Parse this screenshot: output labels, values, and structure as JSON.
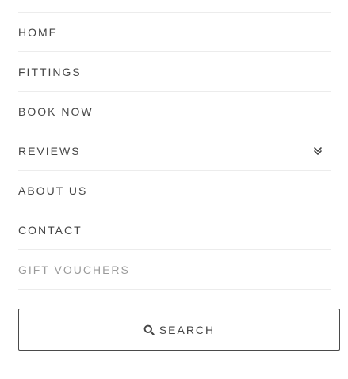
{
  "menu": {
    "items": [
      {
        "label": "HOME",
        "active": false,
        "has_submenu": false
      },
      {
        "label": "FITTINGS",
        "active": false,
        "has_submenu": false
      },
      {
        "label": "BOOK NOW",
        "active": false,
        "has_submenu": false
      },
      {
        "label": "REVIEWS",
        "active": false,
        "has_submenu": true
      },
      {
        "label": "ABOUT US",
        "active": false,
        "has_submenu": false
      },
      {
        "label": "CONTACT",
        "active": false,
        "has_submenu": false
      },
      {
        "label": "GIFT VOUCHERS",
        "active": true,
        "has_submenu": false
      }
    ],
    "submenu_toggle_icon": "double-chevron-down-icon"
  },
  "search": {
    "label": "SEARCH",
    "icon": "search-icon"
  },
  "colors": {
    "text": "#454545",
    "active_text": "#9a9a9a",
    "divider": "#ececec",
    "button_border": "#4a4a4a",
    "background": "#ffffff"
  }
}
